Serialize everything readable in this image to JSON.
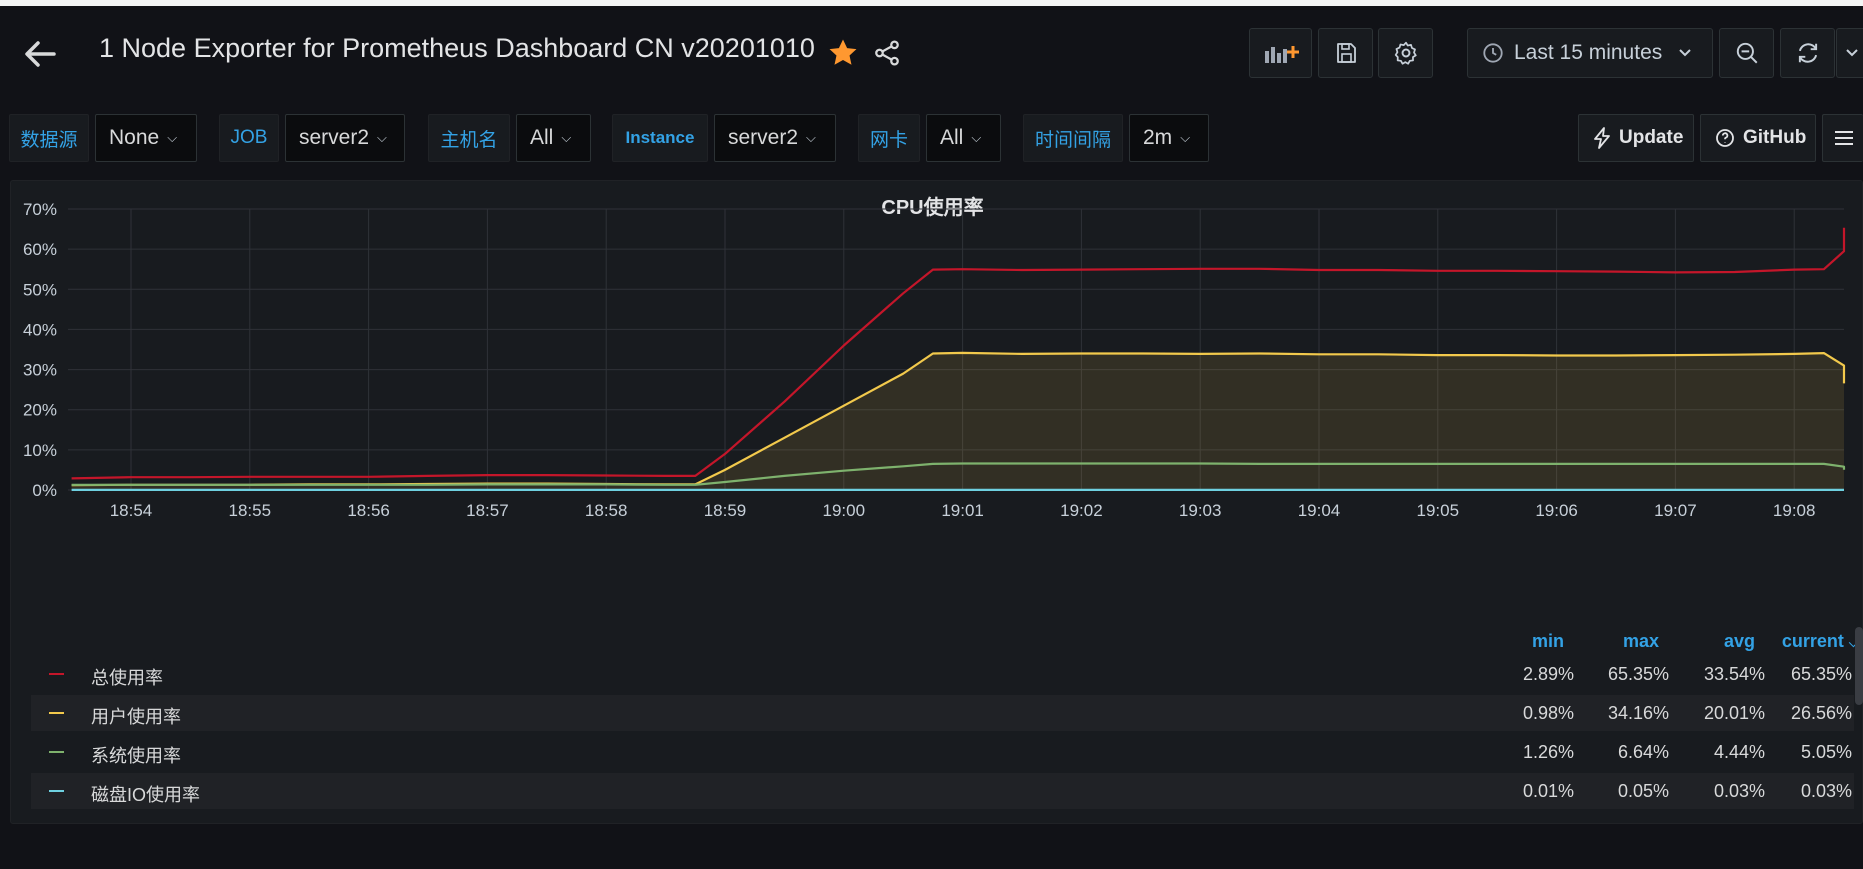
{
  "header": {
    "title": "1 Node Exporter for Prometheus Dashboard CN v20201010",
    "time_range": "Last 15 minutes"
  },
  "variables": [
    {
      "label": "数据源",
      "value": "None"
    },
    {
      "label": "JOB",
      "value": "server2"
    },
    {
      "label": "主机名",
      "value": "All"
    },
    {
      "label": "Instance",
      "value": "server2"
    },
    {
      "label": "网卡",
      "value": "All"
    },
    {
      "label": "时间间隔",
      "value": "2m"
    }
  ],
  "links": {
    "update": "Update",
    "github": "GitHub"
  },
  "icons": {
    "back": "arrow-left-icon",
    "star": "star-icon",
    "share": "share-icon",
    "add_panel": "add-panel-icon",
    "save": "save-icon",
    "settings": "gear-icon",
    "clock": "clock-icon",
    "zoom_out": "zoom-out-icon",
    "refresh": "refresh-icon",
    "bolt": "bolt-icon",
    "github": "info-circle-icon",
    "menu": "hamburger-icon"
  },
  "colors": {
    "background": "#111217",
    "panel": "#181b1f",
    "accent_blue": "#33a2e5",
    "star": "#ff9830",
    "series_total": "#c4162a",
    "series_user": "#f2c94c",
    "series_system": "#7eb26d",
    "series_disk": "#6ed0e0"
  },
  "panel": {
    "title": "CPU使用率",
    "legend_columns": [
      "min",
      "max",
      "avg",
      "current"
    ],
    "legend_rows": [
      {
        "name": "总使用率",
        "min": "2.89%",
        "max": "65.35%",
        "avg": "33.54%",
        "current": "65.35%"
      },
      {
        "name": "用户使用率",
        "min": "0.98%",
        "max": "34.16%",
        "avg": "20.01%",
        "current": "26.56%"
      },
      {
        "name": "系统使用率",
        "min": "1.26%",
        "max": "6.64%",
        "avg": "4.44%",
        "current": "5.05%"
      },
      {
        "name": "磁盘IO使用率",
        "min": "0.01%",
        "max": "0.05%",
        "avg": "0.03%",
        "current": "0.03%"
      }
    ]
  },
  "chart_data": {
    "type": "line",
    "title": "CPU使用率",
    "xlabel": "",
    "ylabel": "",
    "x": [
      "18:53:30",
      "18:54",
      "18:54:30",
      "18:55",
      "18:55:30",
      "18:56",
      "18:56:30",
      "18:57",
      "18:57:30",
      "18:58",
      "18:58:30",
      "18:58:45",
      "18:59",
      "18:59:30",
      "19:00",
      "19:00:30",
      "19:00:45",
      "19:01",
      "19:01:30",
      "19:02",
      "19:02:30",
      "19:03",
      "19:03:30",
      "19:04",
      "19:04:30",
      "19:05",
      "19:05:30",
      "19:06",
      "19:06:30",
      "19:07",
      "19:07:30",
      "19:08",
      "19:08:15",
      "19:08:30",
      "19:08:45"
    ],
    "x_ticks": [
      "18:54",
      "18:55",
      "18:56",
      "18:57",
      "18:58",
      "18:59",
      "19:00",
      "19:01",
      "19:02",
      "19:03",
      "19:04",
      "19:05",
      "19:06",
      "19:07",
      "19:08"
    ],
    "y_ticks": [
      "0%",
      "10%",
      "20%",
      "30%",
      "40%",
      "50%",
      "60%",
      "70%"
    ],
    "ylim": [
      0,
      70
    ],
    "grid": true,
    "legend_position": "bottom",
    "series": [
      {
        "name": "总使用率",
        "color": "#c4162a",
        "fill": false,
        "values": [
          2.9,
          3.2,
          3.2,
          3.3,
          3.3,
          3.3,
          3.5,
          3.7,
          3.7,
          3.6,
          3.5,
          3.5,
          9,
          22,
          36,
          49,
          54.9,
          55,
          54.8,
          54.9,
          55.0,
          55.1,
          55.1,
          54.8,
          54.8,
          54.6,
          54.6,
          54.5,
          54.4,
          54.2,
          54.3,
          54.9,
          55.0,
          59.5,
          65.35
        ]
      },
      {
        "name": "用户使用率",
        "color": "#f2c94c",
        "fill": true,
        "values": [
          1.2,
          1.3,
          1.3,
          1.3,
          1.4,
          1.4,
          1.5,
          1.6,
          1.6,
          1.5,
          1.4,
          1.4,
          5,
          13,
          21,
          29,
          34.0,
          34.16,
          33.9,
          34.0,
          34.0,
          33.9,
          34.0,
          33.8,
          33.8,
          33.6,
          33.6,
          33.5,
          33.5,
          33.6,
          33.7,
          33.9,
          34.1,
          31,
          26.56
        ]
      },
      {
        "name": "系统使用率",
        "color": "#7eb26d",
        "fill": false,
        "values": [
          1.3,
          1.3,
          1.3,
          1.3,
          1.3,
          1.3,
          1.3,
          1.4,
          1.4,
          1.4,
          1.3,
          1.3,
          2.0,
          3.5,
          4.8,
          5.9,
          6.5,
          6.6,
          6.6,
          6.6,
          6.6,
          6.6,
          6.5,
          6.5,
          6.5,
          6.5,
          6.5,
          6.5,
          6.5,
          6.5,
          6.5,
          6.5,
          6.5,
          5.8,
          5.05
        ]
      },
      {
        "name": "磁盘IO使用率",
        "color": "#6ed0e0",
        "fill": false,
        "values": [
          0.03,
          0.03,
          0.03,
          0.03,
          0.03,
          0.03,
          0.03,
          0.03,
          0.03,
          0.03,
          0.03,
          0.03,
          0.03,
          0.03,
          0.03,
          0.03,
          0.03,
          0.03,
          0.03,
          0.03,
          0.03,
          0.03,
          0.03,
          0.03,
          0.03,
          0.03,
          0.03,
          0.03,
          0.03,
          0.03,
          0.03,
          0.03,
          0.03,
          0.03,
          0.03
        ]
      }
    ]
  }
}
